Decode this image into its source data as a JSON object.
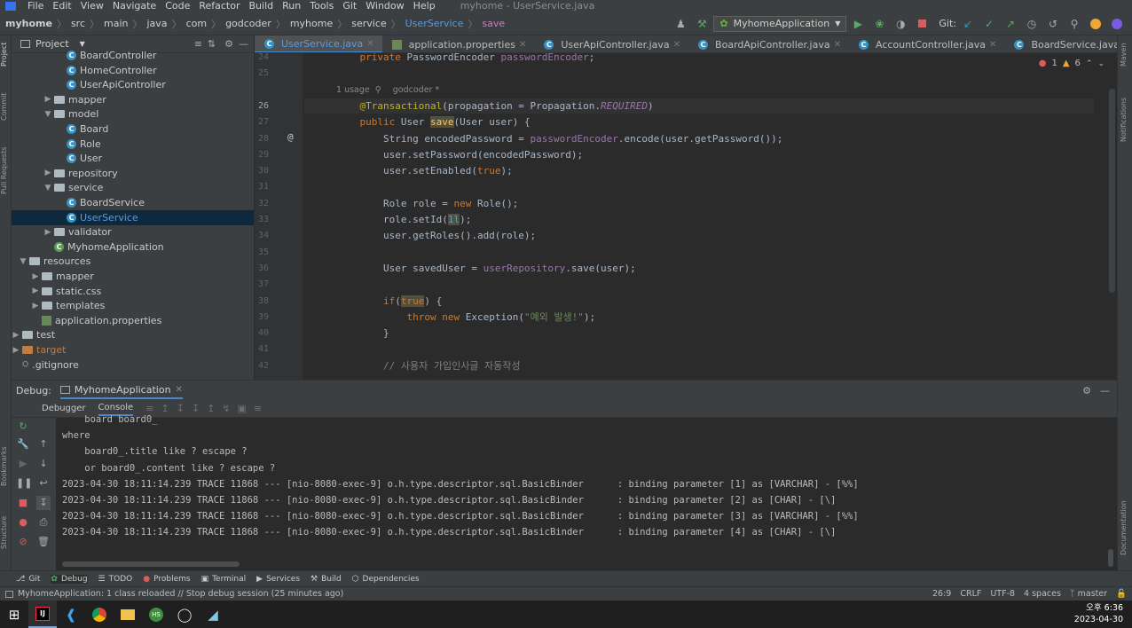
{
  "menu": {
    "items": [
      "File",
      "Edit",
      "View",
      "Navigate",
      "Code",
      "Refactor",
      "Build",
      "Run",
      "Tools",
      "Git",
      "Window",
      "Help"
    ],
    "window_title": "myhome - UserService.java"
  },
  "breadcrumb": {
    "items": [
      "myhome",
      "src",
      "main",
      "java",
      "com",
      "godcoder",
      "myhome",
      "service",
      "UserService",
      "save"
    ]
  },
  "toolbar": {
    "run_config": "MyhomeApplication",
    "git_label": "Git:"
  },
  "project_panel": {
    "title": "Project",
    "tree": [
      {
        "label": "BoardController",
        "kind": "class",
        "depth": 6,
        "expanded": null
      },
      {
        "label": "HomeController",
        "kind": "class",
        "depth": 6,
        "expanded": null
      },
      {
        "label": "UserApiController",
        "kind": "class",
        "depth": 6,
        "expanded": null
      },
      {
        "label": "mapper",
        "kind": "package",
        "depth": 5,
        "expanded": false
      },
      {
        "label": "model",
        "kind": "package",
        "depth": 5,
        "expanded": true
      },
      {
        "label": "Board",
        "kind": "class",
        "depth": 6,
        "expanded": null
      },
      {
        "label": "Role",
        "kind": "class",
        "depth": 6,
        "expanded": null
      },
      {
        "label": "User",
        "kind": "class",
        "depth": 6,
        "expanded": null
      },
      {
        "label": "repository",
        "kind": "package",
        "depth": 5,
        "expanded": false
      },
      {
        "label": "service",
        "kind": "package",
        "depth": 5,
        "expanded": true
      },
      {
        "label": "BoardService",
        "kind": "class",
        "depth": 6,
        "expanded": null
      },
      {
        "label": "UserService",
        "kind": "class",
        "depth": 6,
        "expanded": null,
        "selected": true
      },
      {
        "label": "validator",
        "kind": "package",
        "depth": 5,
        "expanded": false
      },
      {
        "label": "MyhomeApplication",
        "kind": "app",
        "depth": 5,
        "expanded": null
      },
      {
        "label": "resources",
        "kind": "folder",
        "depth": 3,
        "expanded": true
      },
      {
        "label": "mapper",
        "kind": "folder",
        "depth": 4,
        "expanded": false
      },
      {
        "label": "static.css",
        "kind": "folder",
        "depth": 4,
        "expanded": false
      },
      {
        "label": "templates",
        "kind": "folder",
        "depth": 4,
        "expanded": false
      },
      {
        "label": "application.properties",
        "kind": "props",
        "depth": 4,
        "expanded": null
      },
      {
        "label": "test",
        "kind": "folder",
        "depth": 2,
        "expanded": false
      },
      {
        "label": "target",
        "kind": "excluded",
        "depth": 1,
        "expanded": false
      },
      {
        "label": ".gitignore",
        "kind": "file",
        "depth": 1,
        "expanded": null
      }
    ]
  },
  "editor": {
    "tabs": [
      {
        "label": "UserService.java",
        "active": true
      },
      {
        "label": "application.properties",
        "active": false
      },
      {
        "label": "UserApiController.java",
        "active": false
      },
      {
        "label": "BoardApiController.java",
        "active": false
      },
      {
        "label": "AccountController.java",
        "active": false
      },
      {
        "label": "BoardService.java",
        "active": false
      }
    ],
    "inspection": {
      "errors": "1",
      "warnings": "6"
    },
    "usage_hint": "1 usage",
    "author_hint": "godcoder *",
    "lines": [
      {
        "num": "24",
        "html": "    <span class='kw'>private</span> PasswordEncoder <span class='fl'>passwordEncoder</span>;"
      },
      {
        "num": "25",
        "html": ""
      },
      {
        "num": "",
        "html": "__hint__"
      },
      {
        "num": "26",
        "html": "    <span class='an'>@Transactional</span>(propagation = Propagation.<span class='it'>REQUIRED</span>)",
        "current": true
      },
      {
        "num": "27",
        "html": "    <span class='kw'>public</span> User <span class='fn hl'>save</span>(User user) {"
      },
      {
        "num": "28",
        "html": "        String encodedPassword = <span class='fl'>passwordEncoder</span>.encode(user.getPassword());"
      },
      {
        "num": "29",
        "html": "        user.setPassword(encodedPassword);"
      },
      {
        "num": "30",
        "html": "        user.setEnabled(<span class='kw'>true</span>);"
      },
      {
        "num": "31",
        "html": ""
      },
      {
        "num": "32",
        "html": "        Role role = <span class='kw'>new</span> Role();"
      },
      {
        "num": "33",
        "html": "        role.setId(<span class='nm hl'>1l</span>);"
      },
      {
        "num": "34",
        "html": "        user.getRoles().add(role);"
      },
      {
        "num": "35",
        "html": ""
      },
      {
        "num": "36",
        "html": "        User savedUser = <span class='fl'>userRepository</span>.save(user);"
      },
      {
        "num": "37",
        "html": ""
      },
      {
        "num": "38",
        "html": "        <span class='kw'>if</span>(<span class='kw hl'>true</span>) {"
      },
      {
        "num": "39",
        "html": "            <span class='kw'>throw new</span> Exception(<span class='st'>\"예외 발생!\"</span>);"
      },
      {
        "num": "40",
        "html": "        }"
      },
      {
        "num": "41",
        "html": ""
      },
      {
        "num": "42",
        "html": "        <span class='cm'>// 사용자 가입인사글 자동작성</span>"
      }
    ]
  },
  "debug": {
    "label": "Debug:",
    "session": "MyhomeApplication",
    "tabs": [
      "Debugger",
      "Console"
    ],
    "active_tab": "Console",
    "console_lines": [
      "    board board0_",
      "where",
      "    board0_.title like ? escape ?",
      "    or board0_.content like ? escape ?",
      "2023-04-30 18:11:14.239 TRACE 11868 --- [nio-8080-exec-9] o.h.type.descriptor.sql.BasicBinder      : binding parameter [1] as [VARCHAR] - [%%]",
      "2023-04-30 18:11:14.239 TRACE 11868 --- [nio-8080-exec-9] o.h.type.descriptor.sql.BasicBinder      : binding parameter [2] as [CHAR] - [\\]",
      "2023-04-30 18:11:14.239 TRACE 11868 --- [nio-8080-exec-9] o.h.type.descriptor.sql.BasicBinder      : binding parameter [3] as [VARCHAR] - [%%]",
      "2023-04-30 18:11:14.239 TRACE 11868 --- [nio-8080-exec-9] o.h.type.descriptor.sql.BasicBinder      : binding parameter [4] as [CHAR] - [\\]"
    ]
  },
  "tool_windows": {
    "items": [
      "Git",
      "Debug",
      "TODO",
      "Problems",
      "Terminal",
      "Services",
      "Build",
      "Dependencies"
    ],
    "active": "Debug"
  },
  "side_tabs": {
    "left": [
      "Project",
      "Commit",
      "Pull Requests"
    ],
    "left_bottom": [
      "Bookmarks",
      "Structure"
    ],
    "right": [
      "Maven",
      "Notifications"
    ],
    "right_bottom": [
      "Documentation"
    ]
  },
  "status": {
    "message": "MyhomeApplication: 1 class reloaded // Stop debug session (25 minutes ago)",
    "position": "26:9",
    "line_sep": "CRLF",
    "encoding": "UTF-8",
    "indent": "4 spaces",
    "branch": "master"
  },
  "taskbar": {
    "time": "오후 6:36",
    "date": "2023-04-30"
  }
}
